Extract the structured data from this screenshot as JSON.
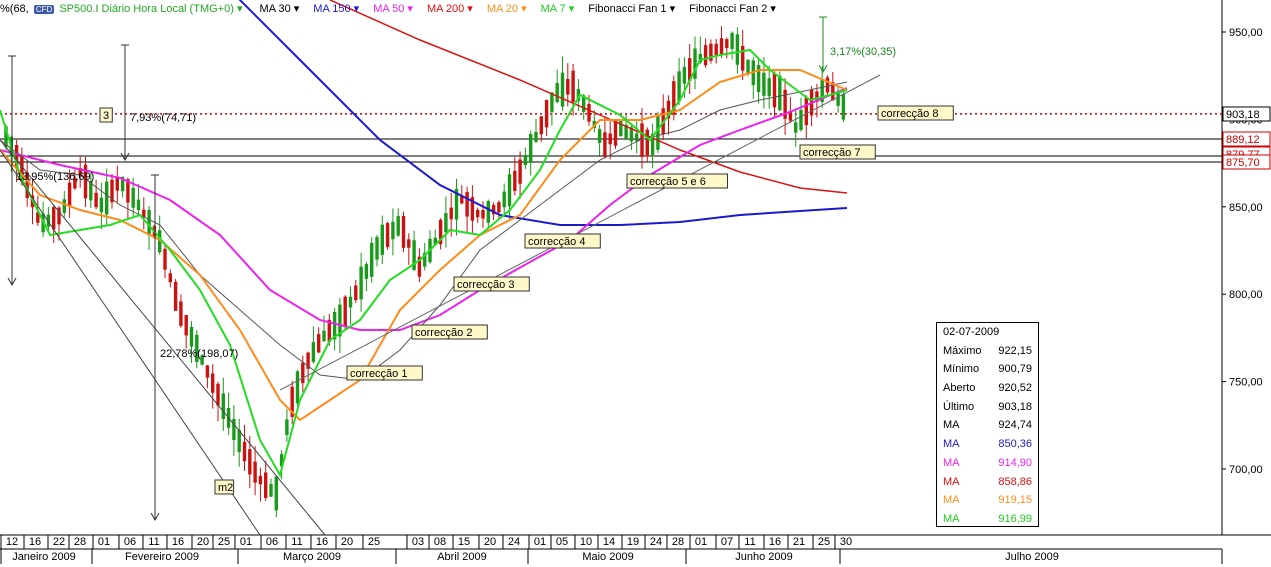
{
  "toolbar": {
    "prefix": "%(68,",
    "logo": "CFD",
    "symbol_label": "SP500.I Diário Hora Local (TMG+0)",
    "items": [
      {
        "label": "MA 30",
        "color": "#000000"
      },
      {
        "label": "MA 150",
        "color": "#1a1acc"
      },
      {
        "label": "MA 50",
        "color": "#ee22ee"
      },
      {
        "label": "MA 200",
        "color": "#dd1111"
      },
      {
        "label": "MA 20",
        "color": "#ff8c1a"
      },
      {
        "label": "MA 7",
        "color": "#22cc22"
      },
      {
        "label": "Fibonacci Fan 1",
        "color": "#000000"
      },
      {
        "label": "Fibonacci Fan 2",
        "color": "#000000"
      }
    ]
  },
  "chart_data": {
    "type": "candlestick",
    "y_axis": {
      "range": [
        660,
        960
      ],
      "ticks": [
        "950,00",
        "900,00",
        "850,00",
        "800,00",
        "750,00",
        "700,00"
      ],
      "tick_values": [
        950,
        900,
        850,
        800,
        750,
        700
      ]
    },
    "price_labels": [
      {
        "text": "903,18",
        "value": 903.18,
        "style": "current"
      },
      {
        "text": "889,12",
        "value": 889.12,
        "style": "red"
      },
      {
        "text": "879,77",
        "value": 879.77,
        "style": "red"
      },
      {
        "text": "875,70",
        "value": 875.7,
        "style": "red"
      }
    ],
    "date_ticks": [
      "12",
      "16",
      "22",
      "28",
      "01",
      "06",
      "11",
      "16",
      "20",
      "25",
      "01",
      "06",
      "11",
      "16",
      "20",
      "25",
      "03",
      "08",
      "15",
      "20",
      "24",
      "01",
      "05",
      "10",
      "14",
      "19",
      "24",
      "28",
      "01",
      "07",
      "11",
      "16",
      "21",
      "25",
      "30"
    ],
    "months": [
      "Janeiro 2009",
      "Fevereiro 2009",
      "Março 2009",
      "Abril 2009",
      "Maio 2009",
      "Junho 2009",
      "Julho 2009"
    ],
    "annotations": [
      {
        "text": "correcção 1",
        "kind": "box"
      },
      {
        "text": "correcção 2",
        "kind": "box"
      },
      {
        "text": "correcção 3",
        "kind": "box"
      },
      {
        "text": "correcção 4",
        "kind": "box"
      },
      {
        "text": "correcção 5 e 6",
        "kind": "box"
      },
      {
        "text": "correcção 7",
        "kind": "box"
      },
      {
        "text": "correcção 8",
        "kind": "box"
      },
      {
        "text": "m2",
        "kind": "box"
      },
      {
        "text": "3",
        "kind": "box"
      },
      {
        "text": "7,93%(74,71)",
        "kind": "text"
      },
      {
        "text": "13,95%(136,69)",
        "kind": "text"
      },
      {
        "text": "22,78%(198,07)",
        "kind": "text"
      },
      {
        "text": "3,17%(30,35)",
        "kind": "text",
        "color": "#1a8a1a"
      }
    ],
    "grid": false
  },
  "info_box": {
    "date": "02-07-2009",
    "rows": [
      {
        "label": "Máximo",
        "value": "922,15",
        "color": "#000000"
      },
      {
        "label": "Mínimo",
        "value": "900,79",
        "color": "#000000"
      },
      {
        "label": "Aberto",
        "value": "920,52",
        "color": "#000000"
      },
      {
        "label": "Último",
        "value": "903,18",
        "color": "#000000"
      },
      {
        "label": "MA",
        "value": "924,74",
        "color": "#000000"
      },
      {
        "label": "MA",
        "value": "850,36",
        "color": "#1a1acc"
      },
      {
        "label": "MA",
        "value": "914,90",
        "color": "#ee22ee"
      },
      {
        "label": "MA",
        "value": "858,86",
        "color": "#dd1111"
      },
      {
        "label": "MA",
        "value": "919,15",
        "color": "#ff8c1a"
      },
      {
        "label": "MA",
        "value": "916,99",
        "color": "#22cc22"
      }
    ]
  }
}
